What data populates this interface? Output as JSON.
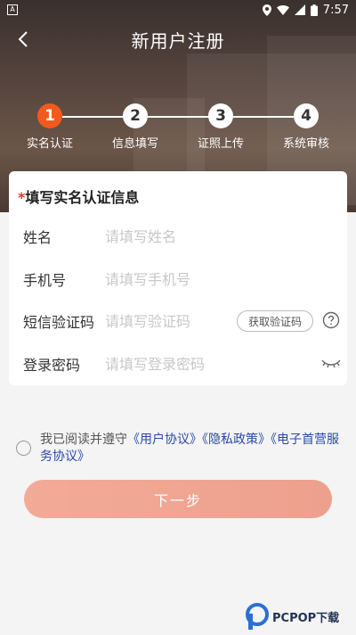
{
  "status_bar": {
    "time": "7:57"
  },
  "header": {
    "title": "新用户注册"
  },
  "steps": [
    {
      "number": "1",
      "label": "实名认证",
      "active": true
    },
    {
      "number": "2",
      "label": "信息填写",
      "active": false
    },
    {
      "number": "3",
      "label": "证照上传",
      "active": false
    },
    {
      "number": "4",
      "label": "系统审核",
      "active": false
    }
  ],
  "form": {
    "heading_star": "*",
    "heading": "填写实名认证信息",
    "name": {
      "label": "姓名",
      "placeholder": "请填写姓名",
      "value": ""
    },
    "phone": {
      "label": "手机号",
      "placeholder": "请填写手机号",
      "value": ""
    },
    "sms": {
      "label": "短信验证码",
      "placeholder": "请填写验证码",
      "value": "",
      "button": "获取验证码"
    },
    "password": {
      "label": "登录密码",
      "placeholder": "请填写登录密码",
      "value": ""
    }
  },
  "agreement": {
    "prefix": "我已阅读并遵守",
    "links": [
      "《用户协议》",
      "《隐私政策》",
      "《电子首营服务协议》"
    ]
  },
  "actions": {
    "next_label": "下一步"
  },
  "watermark": {
    "text": "PCPOP下载"
  },
  "colors": {
    "accent": "#f05a1e",
    "button": "#eda08d",
    "link": "#2b4aa8"
  }
}
